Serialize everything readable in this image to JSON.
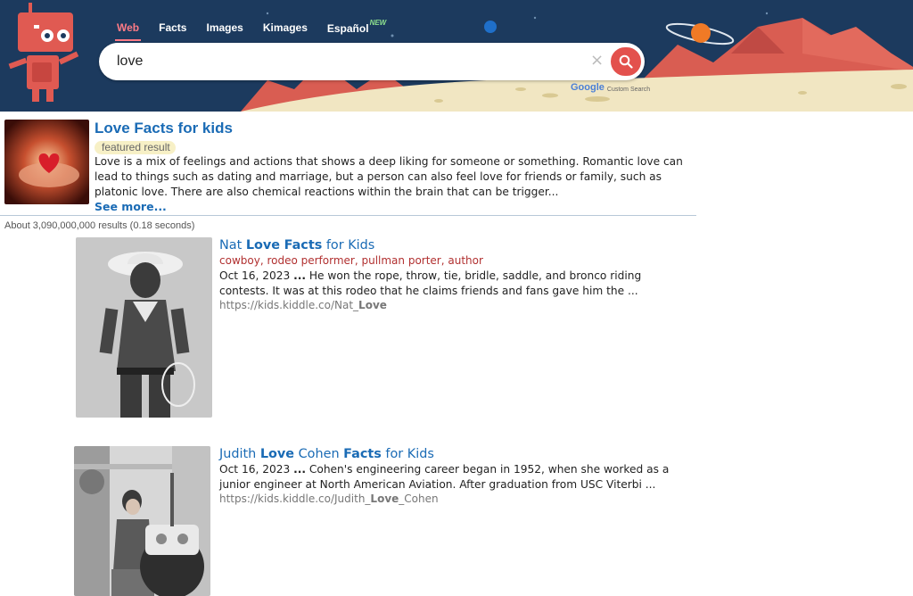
{
  "nav": {
    "items": [
      {
        "label": "Web",
        "active": true
      },
      {
        "label": "Facts",
        "active": false
      },
      {
        "label": "Images",
        "active": false
      },
      {
        "label": "Kimages",
        "active": false
      },
      {
        "label": "Español",
        "active": false,
        "badge": "NEW"
      }
    ]
  },
  "search": {
    "value": "love",
    "clear_icon": "×",
    "powered_by": "Google",
    "powered_by_suffix": "Custom Search"
  },
  "featured": {
    "title": "Love Facts for kids",
    "badge": "featured result",
    "snippet": "Love is a mix of feelings and actions that shows a deep liking for someone or something. Romantic love can lead to things such as dating and marriage, but a person can also feel love for friends or family, such as platonic love. There are also chemical reactions within the brain that can be trigger...",
    "more": "See more..."
  },
  "stats": "About 3,090,000,000 results (0.18 seconds)",
  "results": [
    {
      "title_parts": [
        {
          "text": "Nat ",
          "bold": false
        },
        {
          "text": "Love",
          "bold": true
        },
        {
          "text": " ",
          "bold": false
        },
        {
          "text": "Facts",
          "bold": true
        },
        {
          "text": " for Kids",
          "bold": false
        }
      ],
      "subtitle": "cowboy, rodeo performer, pullman porter, author",
      "date": "Oct 16, 2023",
      "ellipsis": "...",
      "snippet": " He won the rope, throw, tie, bridle, saddle, and bronco riding contests. It was at this rodeo that he claims friends and fans gave him the ...",
      "url_prefix": "https://kids.kiddle.co/Nat_",
      "url_bold": "Love",
      "url_suffix": ""
    },
    {
      "title_parts": [
        {
          "text": "Judith ",
          "bold": false
        },
        {
          "text": "Love",
          "bold": true
        },
        {
          "text": " Cohen ",
          "bold": false
        },
        {
          "text": "Facts",
          "bold": true
        },
        {
          "text": " for Kids",
          "bold": false
        }
      ],
      "subtitle": "",
      "date": "Oct 16, 2023",
      "ellipsis": "...",
      "snippet": " Cohen's engineering career began in 1952, when she worked as a junior engineer at North American Aviation. After graduation from USC Viterbi ...",
      "url_prefix": "https://kids.kiddle.co/Judith_",
      "url_bold": "Love",
      "url_suffix": "_Cohen"
    }
  ],
  "colors": {
    "header_bg": "#1c3a5e",
    "link": "#1a6bb5",
    "accent": "#e3514d",
    "subtitle": "#b13030"
  }
}
